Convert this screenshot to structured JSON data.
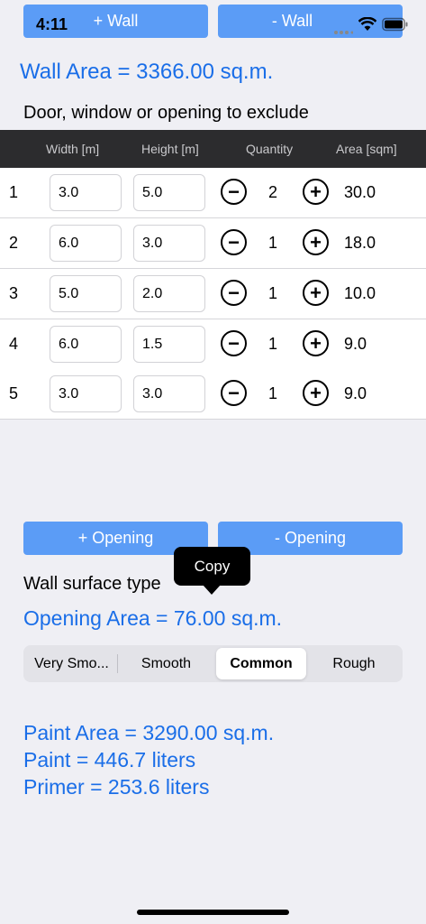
{
  "status": {
    "time": "4:11"
  },
  "top_buttons": {
    "add_wall": "+ Wall",
    "remove_wall": "- Wall"
  },
  "wall_area": "Wall Area = 3366.00 sq.m.",
  "exclude_title": "Door, window or opening to exclude",
  "table": {
    "headers": [
      "Width [m]",
      "Height [m]",
      "Quantity",
      "Area [sqm]"
    ],
    "rows": [
      {
        "index": "1",
        "width": "3.0",
        "height": "5.0",
        "quantity": "2",
        "area": "30.0"
      },
      {
        "index": "2",
        "width": "6.0",
        "height": "3.0",
        "quantity": "1",
        "area": "18.0"
      },
      {
        "index": "3",
        "width": "5.0",
        "height": "2.0",
        "quantity": "1",
        "area": "10.0"
      },
      {
        "index": "4",
        "width": "6.0",
        "height": "1.5",
        "quantity": "1",
        "area": "9.0"
      },
      {
        "index": "5",
        "width": "3.0",
        "height": "3.0",
        "quantity": "1",
        "area": "9.0"
      }
    ],
    "minus_symbol": "−",
    "plus_symbol": "+"
  },
  "opening_buttons": {
    "add_opening": "+ Opening",
    "remove_opening": "- Opening"
  },
  "tooltip": "Copy",
  "surface_label": "Wall surface type",
  "opening_area": "Opening Area = 76.00 sq.m.",
  "surface_options": [
    "Very Smo...",
    "Smooth",
    "Common",
    "Rough"
  ],
  "surface_selected": "Common",
  "results": {
    "paint_area": "Paint Area = 3290.00 sq.m.",
    "paint": "Paint = 446.7 liters",
    "primer": "Primer = 253.6 liters"
  },
  "colors": {
    "accent": "#1a6ee8",
    "button": "#5b9cf6",
    "header_bg": "#2c2c2e"
  },
  "icons": [
    "minus-circle-icon",
    "plus-circle-icon",
    "wifi-icon",
    "battery-icon",
    "signal-icon"
  ]
}
